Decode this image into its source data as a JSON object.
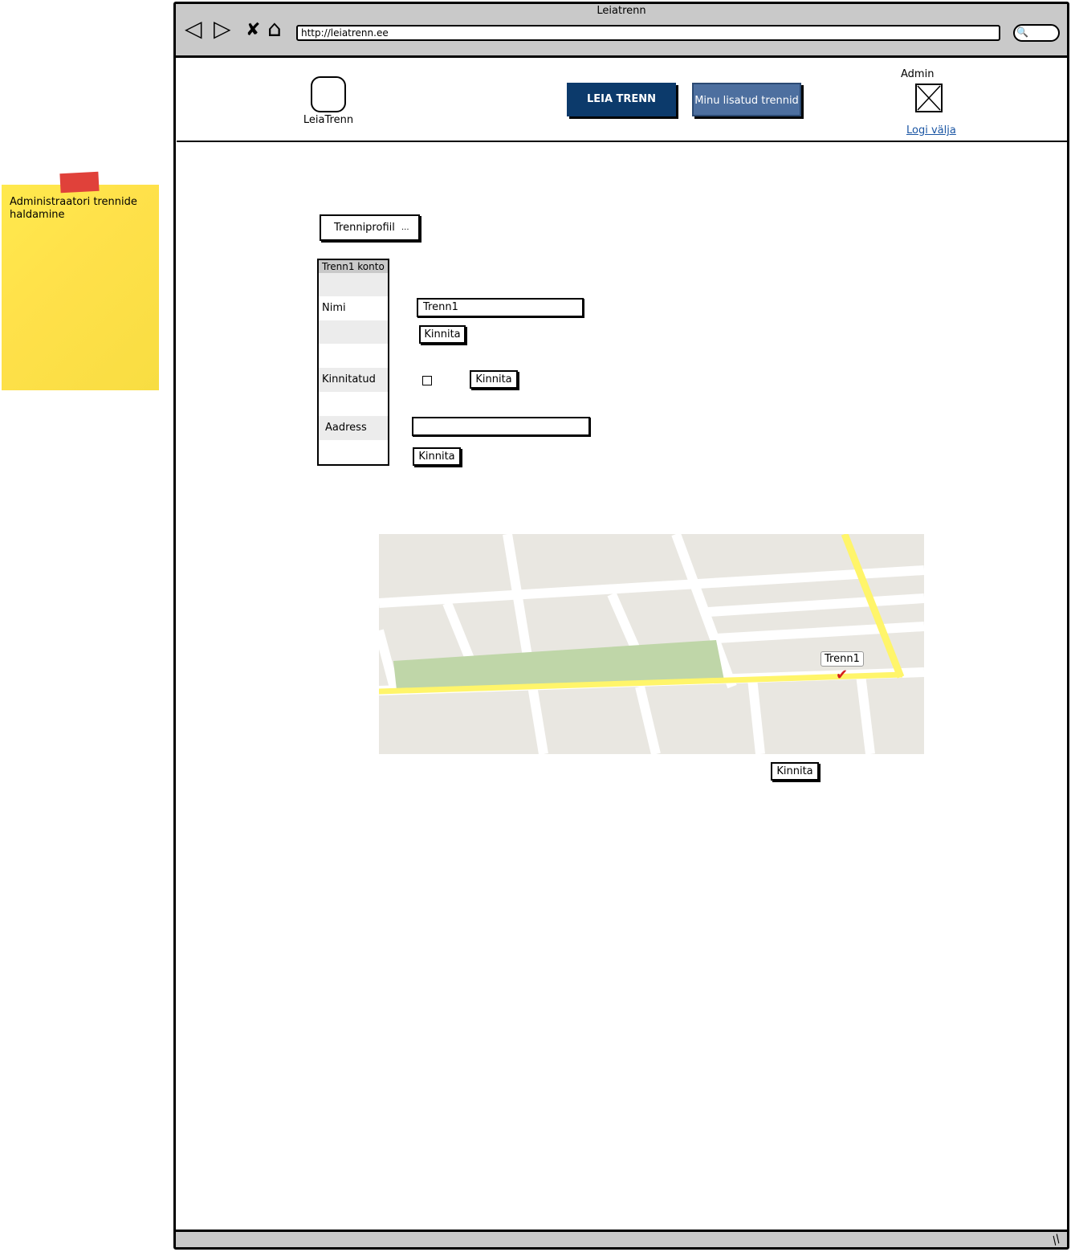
{
  "sticky_note": {
    "text": "Administraatori trennide haldamine"
  },
  "browser": {
    "title": "Leiatrenn",
    "url": "http://leiatrenn.ee",
    "nav_icons": {
      "back": "◁",
      "forward": "▷",
      "stop": "✘",
      "home": "⌂",
      "search": "🔍"
    },
    "resize_icon": "//"
  },
  "header": {
    "logo_label": "LeiaTrenn",
    "nav": {
      "leia_trenn": "LEIA TRENN",
      "minu_lisatud": "Minu lisatud trennid"
    },
    "user": {
      "name": "Admin",
      "logout": "Logi välja"
    },
    "colors": {
      "primary_button": "#0c3a6b",
      "secondary_button": "#4d6f9f",
      "link": "#1a55a3"
    }
  },
  "profile_menu": {
    "label": "Trenniprofiil",
    "caret": "..."
  },
  "form": {
    "section_title": "Trenn1 konto",
    "labels": {
      "name": "Nimi",
      "approved": "Kinnitatud",
      "address": "Aadress"
    },
    "name_value": "Trenn1",
    "address_value": "",
    "approved_checked": false,
    "confirm_label": "Kinnita"
  },
  "map": {
    "marker_label": "Trenn1",
    "confirm_label": "Kinnita",
    "pin": "✔"
  }
}
